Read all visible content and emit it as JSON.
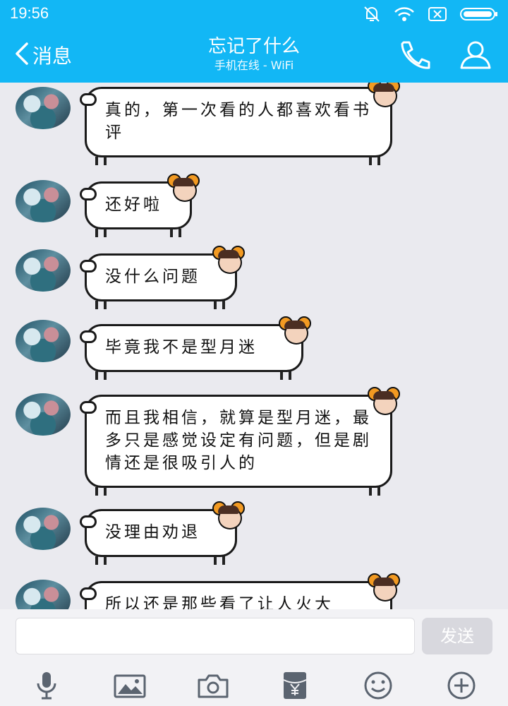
{
  "status": {
    "time": "19:56"
  },
  "header": {
    "back_label": "消息",
    "title": "忘记了什么",
    "subtitle": "手机在线 - WiFi"
  },
  "messages": [
    {
      "text": "真的，第一次看的人都喜欢看书评"
    },
    {
      "text": "还好啦"
    },
    {
      "text": "没什么问题"
    },
    {
      "text": "毕竟我不是型月迷"
    },
    {
      "text": "而且我相信，就算是型月迷，最多只是感觉设定有问题，但是剧情还是很吸引人的"
    },
    {
      "text": "没理由劝退"
    },
    {
      "text": "所以还是那些看了让人火大"
    }
  ],
  "input": {
    "value": "",
    "send_label": "发送"
  },
  "toolbar_icons": [
    "microphone-icon",
    "image-icon",
    "camera-icon",
    "red-packet-icon",
    "emoji-icon",
    "plus-icon"
  ],
  "colors": {
    "header_bg": "#12b7f5",
    "page_bg": "#eaeaef",
    "send_disabled": "#d8d8de"
  }
}
